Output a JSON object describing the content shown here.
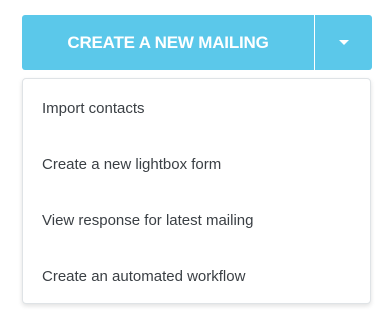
{
  "create_button": {
    "label": "CREATE A NEW MAILING",
    "dropdown_icon": "caret-down-icon"
  },
  "menu": {
    "items": [
      {
        "label": "Import contacts"
      },
      {
        "label": "Create a new lightbox form"
      },
      {
        "label": "View response for latest mailing"
      },
      {
        "label": "Create an automated workflow"
      }
    ]
  },
  "colors": {
    "button_bg": "#5bc8ea",
    "button_text": "#ffffff",
    "menu_text": "#3a3f44",
    "menu_border": "#dfe3e6"
  }
}
